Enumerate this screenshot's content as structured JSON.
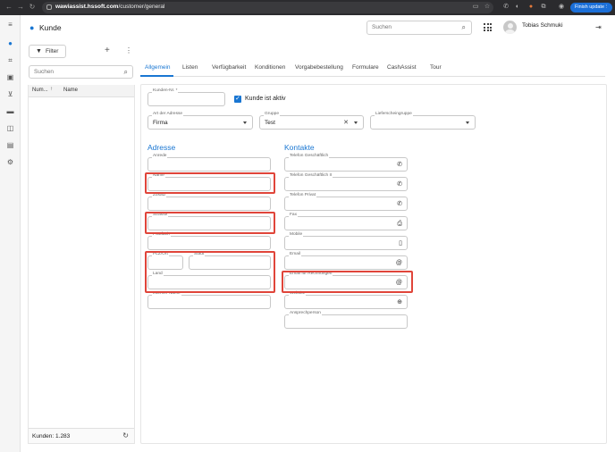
{
  "browser": {
    "url_host": "wawiassist.hssoft.com",
    "url_path": "/customer/general",
    "update_button": "Finish update"
  },
  "header": {
    "title": "Kunde",
    "search_placeholder": "Suchen",
    "user_name": "Tobias Schmuki"
  },
  "list": {
    "filter_label": "Filter",
    "search_placeholder": "Suchen",
    "col_number": "Num...",
    "col_name": "Name",
    "count_text": "Kunden: 1.283"
  },
  "tabs": [
    "Allgemein",
    "Listen",
    "Verfügbarkeit",
    "Konditionen",
    "Vorgabebestellung",
    "Formulare",
    "CashAssist",
    "Tour"
  ],
  "general": {
    "customer_number_label": "Kunden-Nr. *",
    "customer_number_value": "",
    "active_label": "Kunde ist aktiv",
    "active_checked": true,
    "address_type_label": "Art der Adresse",
    "address_type_value": "Firma",
    "group_label": "Gruppe",
    "group_value": "Test",
    "delivery_group_label": "Lieferscheingruppe",
    "delivery_group_value": ""
  },
  "address": {
    "title": "Adresse",
    "salutation": "Anrede",
    "name": "Name",
    "addition": "Zusatz",
    "street": "Strasse",
    "po_box": "Postfach",
    "zip": "PLZ/Ort",
    "city": "Stadt",
    "country": "Land",
    "internal_name": "Interner Name"
  },
  "contacts": {
    "title": "Kontakte",
    "phone_business": "Telefon Geschäftlich",
    "phone_business2": "Telefon Geschäftlich II",
    "phone_private": "Telefon Privat",
    "fax": "Fax",
    "mobile": "Mobile",
    "email": "Email",
    "email_invoices": "Email für Rechnungen",
    "website": "Website",
    "contact_person": "Ansprechperson"
  },
  "colors": {
    "accent": "#1976d2",
    "highlight": "#e0453a",
    "chrome": "#2b2b2e"
  }
}
